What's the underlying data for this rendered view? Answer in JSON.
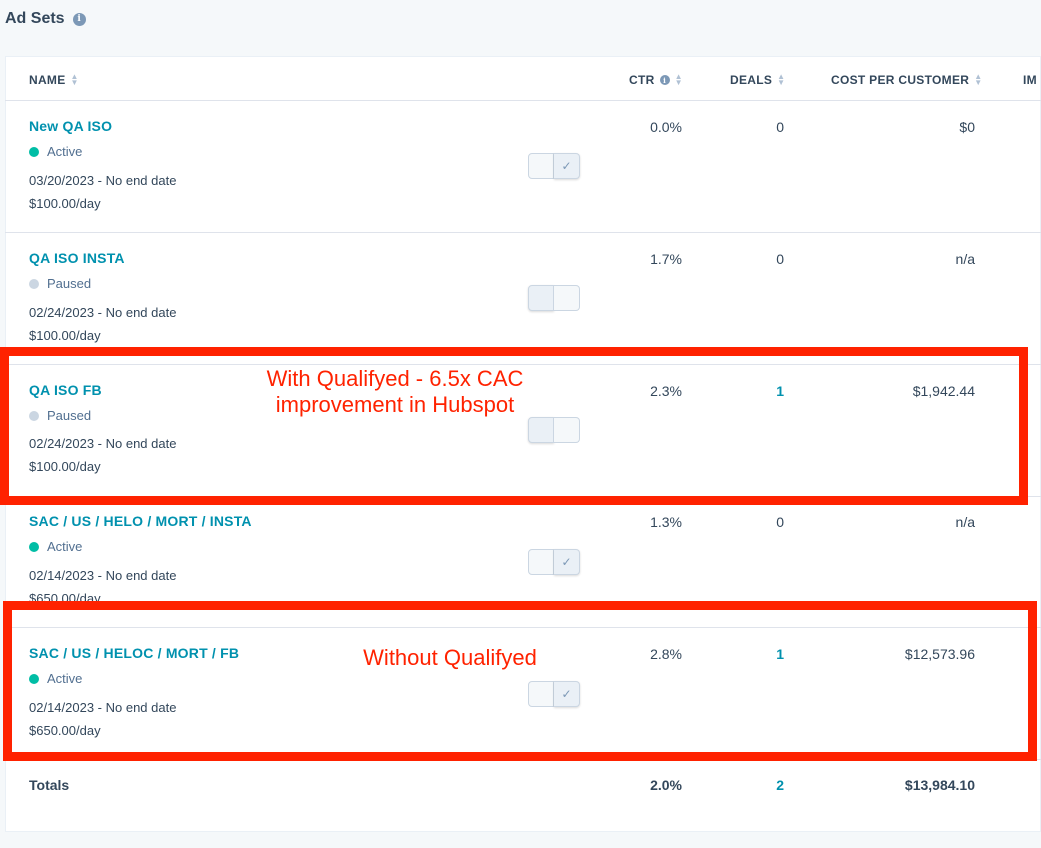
{
  "header": {
    "title": "Ad Sets",
    "info_icon": "info-icon"
  },
  "columns": {
    "name": "NAME",
    "ctr": "CTR",
    "deals": "DEALS",
    "cost": "COST PER CUSTOMER",
    "im": "IM"
  },
  "rows": [
    {
      "name": "New QA ISO",
      "status": "Active",
      "date": "03/20/2023 - No end date",
      "budget": "$100.00/day",
      "ctr": "0.0%",
      "deals": "0",
      "cost": "$0",
      "toggle": "on"
    },
    {
      "name": "QA ISO INSTA",
      "status": "Paused",
      "date": "02/24/2023 - No end date",
      "budget": "$100.00/day",
      "ctr": "1.7%",
      "deals": "0",
      "cost": "n/a",
      "toggle": "off"
    },
    {
      "name": "QA ISO FB",
      "status": "Paused",
      "date": "02/24/2023 - No end date",
      "budget": "$100.00/day",
      "ctr": "2.3%",
      "deals": "1",
      "cost": "$1,942.44",
      "toggle": "off"
    },
    {
      "name": "SAC / US / HELO / MORT / INSTA",
      "status": "Active",
      "date": "02/14/2023 - No end date",
      "budget": "$650.00/day",
      "ctr": "1.3%",
      "deals": "0",
      "cost": "n/a",
      "toggle": "on"
    },
    {
      "name": "SAC / US / HELOC / MORT / FB",
      "status": "Active",
      "date": "02/14/2023 - No end date",
      "budget": "$650.00/day",
      "ctr": "2.8%",
      "deals": "1",
      "cost": "$12,573.96",
      "toggle": "on"
    }
  ],
  "totals": {
    "label": "Totals",
    "ctr": "2.0%",
    "deals": "2",
    "cost": "$13,984.10"
  },
  "annotations": {
    "with_line1": "With Qualifyed - 6.5x CAC",
    "with_line2": "improvement in Hubspot",
    "without": "Without Qualifyed"
  },
  "colors": {
    "link": "#0091ae",
    "active": "#00bda5",
    "paused": "#cbd6e2",
    "annotation": "#ff2200"
  }
}
